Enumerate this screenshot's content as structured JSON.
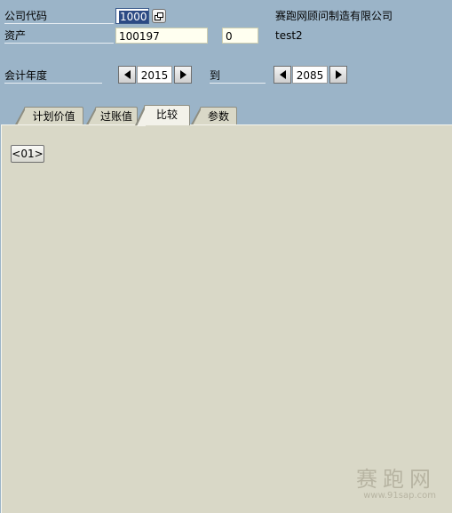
{
  "header": {
    "company_code_label": "公司代码",
    "company_code_value": "1000",
    "company_name": "赛跑网顾问制造有限公司",
    "asset_label": "资产",
    "asset_value": "100197",
    "asset_subnumber": "0",
    "asset_description": "test2",
    "fiscal_year_label": "会计年度",
    "fiscal_year_from": "2015",
    "to_label": "到",
    "fiscal_year_to": "2085"
  },
  "tabs": [
    {
      "label": "计划价值"
    },
    {
      "label": "过账值"
    },
    {
      "label": "比较"
    },
    {
      "label": "参数"
    }
  ],
  "active_tab": "比较",
  "panel": {
    "button_label": "<01>"
  },
  "watermark": {
    "title": "赛跑网",
    "url": "www.91sap.com"
  },
  "colors": {
    "background": "#9bb4c8",
    "panel": "#d9d8c7",
    "input_bg": "#fffff0",
    "selection": "#2c4a84"
  }
}
